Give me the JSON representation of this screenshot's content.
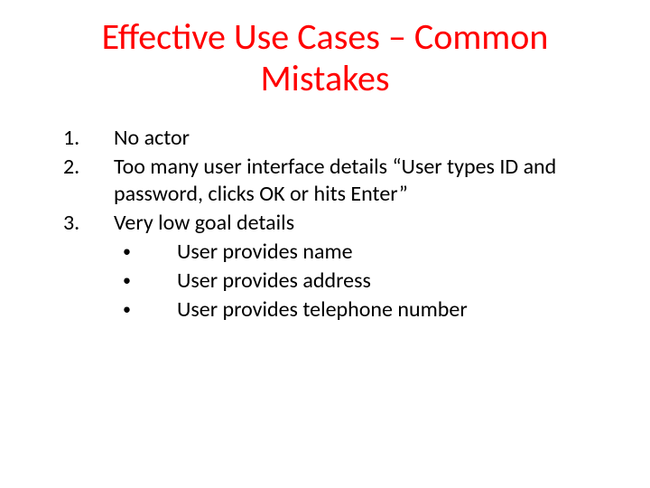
{
  "title": "Effective Use Cases – Common Mistakes",
  "items": [
    {
      "marker": "1.",
      "text": "No actor"
    },
    {
      "marker": "2.",
      "text": "Too many user interface details “User types ID and password, clicks OK or hits Enter”"
    },
    {
      "marker": "3.",
      "text": "Very low goal details"
    }
  ],
  "bullets": [
    {
      "marker": "•",
      "text": "User provides name"
    },
    {
      "marker": "•",
      "text": "User provides address"
    },
    {
      "marker": "•",
      "text": "User provides telephone number"
    }
  ]
}
